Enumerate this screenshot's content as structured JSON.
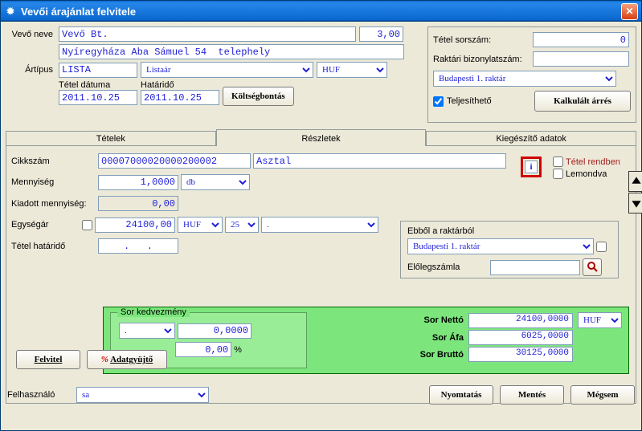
{
  "window": {
    "title": "Vevői árajánlat felvitele"
  },
  "header": {
    "customer_lbl": "Vevő neve",
    "customer_name": "Vevő Bt.",
    "customer_qty": "3,00",
    "customer_addr": "Nyíregyháza Aba Sámuel 54  telephely",
    "pricetype_lbl": "Ártípus",
    "pricetype": "LISTA",
    "pricename": "Listaár",
    "currency": "HUF",
    "datelbl": "Tétel dátuma",
    "date": "2011.10.25",
    "deadlbl": "Határidő",
    "deadline": "2011.10.25",
    "cost_btn": "Költségbontás"
  },
  "right": {
    "line_no_lbl": "Tétel sorszám:",
    "line_no": "0",
    "doc_no_lbl": "Raktári bizonylatszám:",
    "doc_no": "",
    "warehouse": "Budapesti 1. raktár",
    "fulfillable_lbl": "Teljesíthető",
    "fulfillable": true,
    "margin_btn": "Kalkulált árrés"
  },
  "tabs": {
    "t1": "Tételek",
    "t2": "Részletek",
    "t3": "Kiegészítő adatok"
  },
  "detail": {
    "itemno_lbl": "Cikkszám",
    "itemno": "00007000020000200002",
    "itemname": "Asztal",
    "qty_lbl": "Mennyiség",
    "qty": "1,0000",
    "unit": "db",
    "issued_lbl": "Kiadott mennyiség:",
    "issued": "0,00",
    "price_lbl": "Egységár",
    "price": "24100,00",
    "price_cur": "HUF",
    "vat": "25",
    "dot": ".",
    "itemdl_lbl": "Tétel határidő",
    "itemdl": ".   .",
    "chk1": "Tétel rendben",
    "chk2": "Lemondva",
    "stock_lbl": "Ebből a raktárból",
    "stock_wh": "Budapesti 1. raktár",
    "advance_lbl": "Előlegszámla",
    "advance": ""
  },
  "discount": {
    "title": "Sor kedvezmény",
    "sel": ".",
    "val": "0,0000",
    "pct": "0,00",
    "pct_sign": "%"
  },
  "totals": {
    "net_lbl": "Sor Nettó",
    "net": "24100,0000",
    "net_cur": "HUF",
    "vat_lbl": "Sor Áfa",
    "vat": "6025,0000",
    "gross_lbl": "Sor Bruttó",
    "gross": "30125,0000"
  },
  "buttons": {
    "felvitel": "Felvitel",
    "adatgyujto": "Adatgyüjtő",
    "nyomtatas": "Nyomtatás",
    "mentes": "Mentés",
    "megsem": "Mégsem"
  },
  "footer": {
    "user_lbl": "Felhasználó",
    "user": "sa"
  }
}
